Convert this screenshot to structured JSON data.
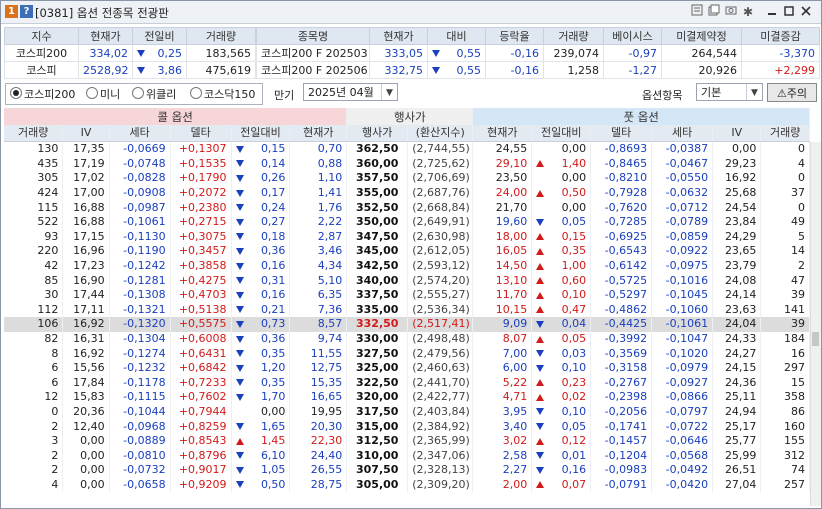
{
  "window": {
    "title": "[0381] 옵션 전종목 전광판",
    "icons": [
      "number-1-icon",
      "question-icon"
    ],
    "toolbar_icons": [
      "pin-icon",
      "copy-icon",
      "camera-icon",
      "gear-icon",
      "minimize-icon",
      "maximize-icon",
      "close-icon"
    ]
  },
  "index_table": {
    "headers": [
      "지수",
      "현재가",
      "전일비",
      "거래량"
    ],
    "rows": [
      {
        "name": "코스피200",
        "price": "334,02",
        "dir": "down",
        "change": "0,25",
        "volume": "183,565"
      },
      {
        "name": "코스피",
        "price": "2528,92",
        "dir": "down",
        "change": "3,86",
        "volume": "475,619"
      }
    ]
  },
  "futures_table": {
    "headers": [
      "종목명",
      "현재가",
      "대비",
      "등락율",
      "거래량",
      "베이시스",
      "미결제약정",
      "미결증감"
    ],
    "rows": [
      {
        "name": "코스피200 F 202503",
        "price": "333,05",
        "dir": "down",
        "change": "0,55",
        "rate": "-0,16",
        "volume": "239,074",
        "basis": "-0,97",
        "oi": "264,544",
        "oi_change": "-3,370",
        "oi_color": "blue"
      },
      {
        "name": "코스피200 F 202506",
        "price": "332,75",
        "dir": "down",
        "change": "0,55",
        "rate": "-0,16",
        "volume": "1,258",
        "basis": "-1,27",
        "oi": "20,926",
        "oi_change": "+2,299",
        "oi_color": "red"
      }
    ]
  },
  "controls": {
    "radios": [
      "코스피200",
      "미니",
      "위클리",
      "코스닥150"
    ],
    "selected_radio": 0,
    "expiry_label": "만기",
    "expiry_value": "2025년 04월",
    "option_items_label": "옵션항목",
    "option_items_value": "기본",
    "notice_button": "주의"
  },
  "board": {
    "call_title": "콜 옵션",
    "strike_title": "행사가",
    "put_title": "풋 옵션",
    "headers": [
      "거래량",
      "IV",
      "세타",
      "델타",
      "전일대비",
      "현재가",
      "행사가",
      "(환산지수)",
      "현재가",
      "전일대비",
      "델타",
      "세타",
      "IV",
      "거래량"
    ],
    "highlight_row": 12,
    "rows": [
      [
        "130",
        "17,35",
        "-0,0669",
        "+0,1307",
        "down",
        "0,15",
        "0,70",
        "362,50",
        "(2,744,55)",
        "24,55",
        "",
        "0,00",
        "-0,8693",
        "-0,0387",
        "0,00",
        "0"
      ],
      [
        "435",
        "17,19",
        "-0,0748",
        "+0,1535",
        "down",
        "0,14",
        "0,88",
        "360,00",
        "(2,725,62)",
        "29,10",
        "up",
        "1,40",
        "-0,8465",
        "-0,0467",
        "29,23",
        "4"
      ],
      [
        "305",
        "17,02",
        "-0,0828",
        "+0,1790",
        "down",
        "0,26",
        "1,10",
        "357,50",
        "(2,706,69)",
        "23,50",
        "",
        "0,00",
        "-0,8210",
        "-0,0550",
        "16,92",
        "0"
      ],
      [
        "424",
        "17,00",
        "-0,0908",
        "+0,2072",
        "down",
        "0,17",
        "1,41",
        "355,00",
        "(2,687,76)",
        "24,00",
        "up",
        "0,50",
        "-0,7928",
        "-0,0632",
        "25,68",
        "37"
      ],
      [
        "115",
        "16,88",
        "-0,0987",
        "+0,2380",
        "down",
        "0,24",
        "1,76",
        "352,50",
        "(2,668,84)",
        "21,70",
        "",
        "0,00",
        "-0,7620",
        "-0,0712",
        "24,54",
        "0"
      ],
      [
        "522",
        "16,88",
        "-0,1061",
        "+0,2715",
        "down",
        "0,27",
        "2,22",
        "350,00",
        "(2,649,91)",
        "19,60",
        "down",
        "0,05",
        "-0,7285",
        "-0,0789",
        "23,84",
        "49"
      ],
      [
        "93",
        "17,15",
        "-0,1130",
        "+0,3075",
        "down",
        "0,18",
        "2,87",
        "347,50",
        "(2,630,98)",
        "18,00",
        "up",
        "0,15",
        "-0,6925",
        "-0,0859",
        "24,29",
        "5"
      ],
      [
        "220",
        "16,96",
        "-0,1190",
        "+0,3457",
        "down",
        "0,36",
        "3,46",
        "345,00",
        "(2,612,05)",
        "16,05",
        "up",
        "0,35",
        "-0,6543",
        "-0,0922",
        "23,65",
        "14"
      ],
      [
        "42",
        "17,23",
        "-0,1242",
        "+0,3858",
        "down",
        "0,16",
        "4,34",
        "342,50",
        "(2,593,12)",
        "14,50",
        "up",
        "1,00",
        "-0,6142",
        "-0,0975",
        "23,79",
        "2"
      ],
      [
        "85",
        "16,90",
        "-0,1281",
        "+0,4275",
        "down",
        "0,31",
        "5,10",
        "340,00",
        "(2,574,20)",
        "13,10",
        "up",
        "0,60",
        "-0,5725",
        "-0,1016",
        "24,08",
        "47"
      ],
      [
        "30",
        "17,44",
        "-0,1308",
        "+0,4703",
        "down",
        "0,16",
        "6,35",
        "337,50",
        "(2,555,27)",
        "11,70",
        "up",
        "0,10",
        "-0,5297",
        "-0,1045",
        "24,14",
        "39"
      ],
      [
        "112",
        "17,11",
        "-0,1321",
        "+0,5138",
        "down",
        "0,21",
        "7,36",
        "335,00",
        "(2,536,34)",
        "10,15",
        "up",
        "0,47",
        "-0,4862",
        "-0,1060",
        "23,63",
        "141"
      ],
      [
        "106",
        "16,92",
        "-0,1320",
        "+0,5575",
        "down",
        "0,73",
        "8,57",
        "332,50",
        "(2,517,41)",
        "9,09",
        "down",
        "0,04",
        "-0,4425",
        "-0,1061",
        "24,04",
        "39"
      ],
      [
        "82",
        "16,31",
        "-0,1304",
        "+0,6008",
        "down",
        "0,36",
        "9,74",
        "330,00",
        "(2,498,48)",
        "8,07",
        "up",
        "0,05",
        "-0,3992",
        "-0,1047",
        "24,33",
        "184"
      ],
      [
        "8",
        "16,92",
        "-0,1274",
        "+0,6431",
        "down",
        "0,35",
        "11,55",
        "327,50",
        "(2,479,56)",
        "7,00",
        "down",
        "0,03",
        "-0,3569",
        "-0,1020",
        "24,27",
        "16"
      ],
      [
        "6",
        "15,56",
        "-0,1232",
        "+0,6842",
        "down",
        "1,20",
        "12,75",
        "325,00",
        "(2,460,63)",
        "6,00",
        "down",
        "0,10",
        "-0,3158",
        "-0,0979",
        "24,15",
        "297"
      ],
      [
        "6",
        "17,84",
        "-0,1178",
        "+0,7233",
        "down",
        "0,35",
        "15,35",
        "322,50",
        "(2,441,70)",
        "5,22",
        "up",
        "0,23",
        "-0,2767",
        "-0,0927",
        "24,36",
        "15"
      ],
      [
        "12",
        "15,83",
        "-0,1115",
        "+0,7602",
        "down",
        "1,70",
        "16,65",
        "320,00",
        "(2,422,77)",
        "4,71",
        "up",
        "0,02",
        "-0,2398",
        "-0,0866",
        "25,11",
        "358"
      ],
      [
        "0",
        "20,36",
        "-0,1044",
        "+0,7944",
        "",
        "0,00",
        "19,95",
        "317,50",
        "(2,403,84)",
        "3,95",
        "down",
        "0,10",
        "-0,2056",
        "-0,0797",
        "24,94",
        "86"
      ],
      [
        "2",
        "12,40",
        "-0,0968",
        "+0,8259",
        "down",
        "1,65",
        "20,30",
        "315,00",
        "(2,384,92)",
        "3,40",
        "down",
        "0,05",
        "-0,1741",
        "-0,0722",
        "25,17",
        "160"
      ],
      [
        "3",
        "0,00",
        "-0,0889",
        "+0,8543",
        "up",
        "1,45",
        "22,30",
        "312,50",
        "(2,365,99)",
        "3,02",
        "up",
        "0,12",
        "-0,1457",
        "-0,0646",
        "25,77",
        "155"
      ],
      [
        "2",
        "0,00",
        "-0,0810",
        "+0,8796",
        "down",
        "6,10",
        "24,40",
        "310,00",
        "(2,347,06)",
        "2,58",
        "down",
        "0,01",
        "-0,1204",
        "-0,0568",
        "25,99",
        "312"
      ],
      [
        "2",
        "0,00",
        "-0,0732",
        "+0,9017",
        "down",
        "1,05",
        "26,55",
        "307,50",
        "(2,328,13)",
        "2,27",
        "down",
        "0,16",
        "-0,0983",
        "-0,0492",
        "26,51",
        "74"
      ],
      [
        "4",
        "0,00",
        "-0,0658",
        "+0,9209",
        "down",
        "0,50",
        "28,75",
        "305,00",
        "(2,309,20)",
        "2,00",
        "up",
        "0,07",
        "-0,0791",
        "-0,0420",
        "27,04",
        "257"
      ]
    ]
  }
}
